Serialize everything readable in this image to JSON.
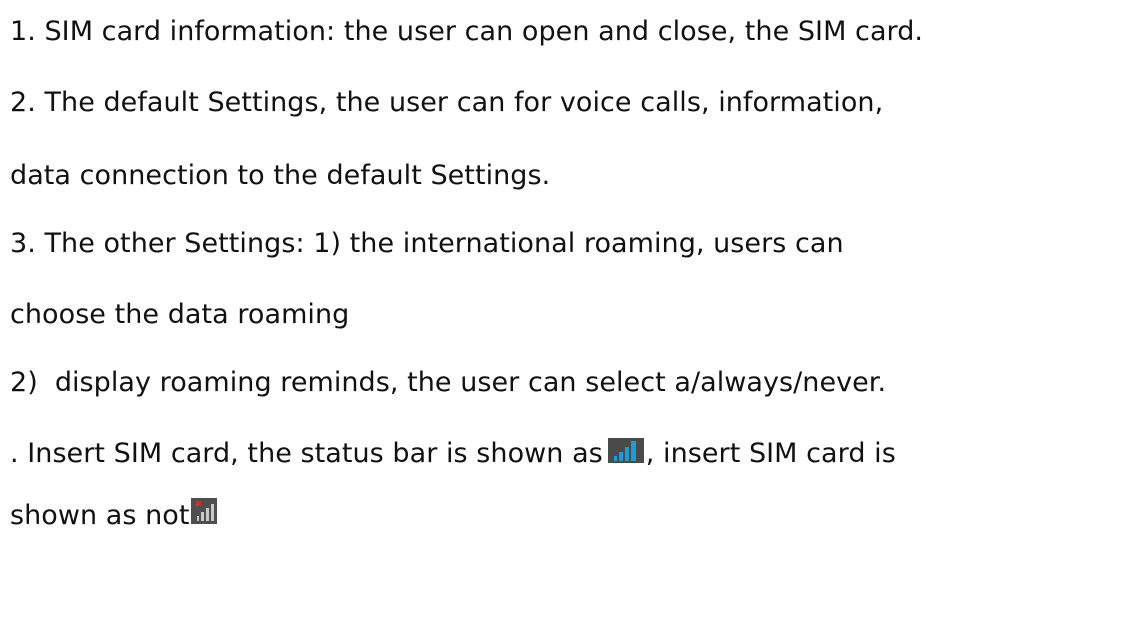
{
  "lines": {
    "l1": "1. SIM card information: the user can open and close, the SIM card.",
    "l2": "2. The default Settings, the user can for voice calls, information,",
    "l3": "data connection to the default Settings.",
    "l4": "3. The other Settings: 1) the international roaming, users can",
    "l5": "choose the data roaming",
    "l6_prefix": "2)",
    "l6_text": "display roaming reminds, the user can select a/always/never.",
    "l7_before": ". Insert SIM card, the status bar is shown as",
    "l7_after": ", insert SIM card is",
    "l8": "shown as not"
  },
  "icons": {
    "signal_full": "signal-bars-icon",
    "signal_no_sim": "signal-no-sim-icon"
  },
  "colors": {
    "text": "#111111",
    "signal_bg": "#4a4a4a",
    "signal_bars": "#1d9bd8",
    "no_sim_bg": "#4f4f4f",
    "no_sim_bars": "#c8c8c8",
    "no_sim_x": "#d23030"
  }
}
